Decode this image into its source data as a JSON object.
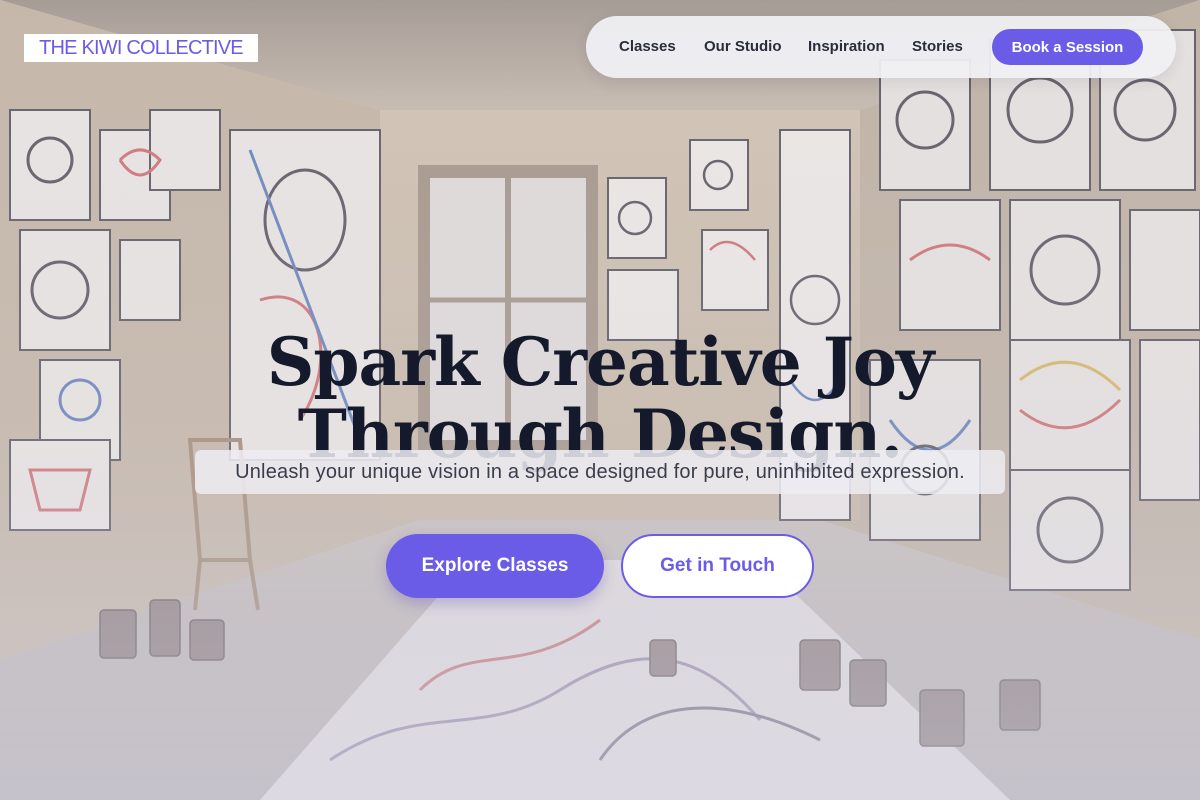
{
  "brand": {
    "logo_text": "THE KIWI COLLECTIVE",
    "accent_color": "#6b5ce7",
    "heading_color": "#141a2b"
  },
  "nav": {
    "links": [
      "Classes",
      "Our Studio",
      "Inspiration",
      "Stories"
    ],
    "cta_label": "Book a Session"
  },
  "hero": {
    "headline_line1": "Spark Creative Joy",
    "headline_line2": "Through Design.",
    "subheadline": "Unleash your unique vision in a space designed for pure, uninhibited expression.",
    "primary_button": "Explore Classes",
    "secondary_button": "Get in Touch",
    "background_image": "art-studio-room-with-doodle-paintings"
  }
}
